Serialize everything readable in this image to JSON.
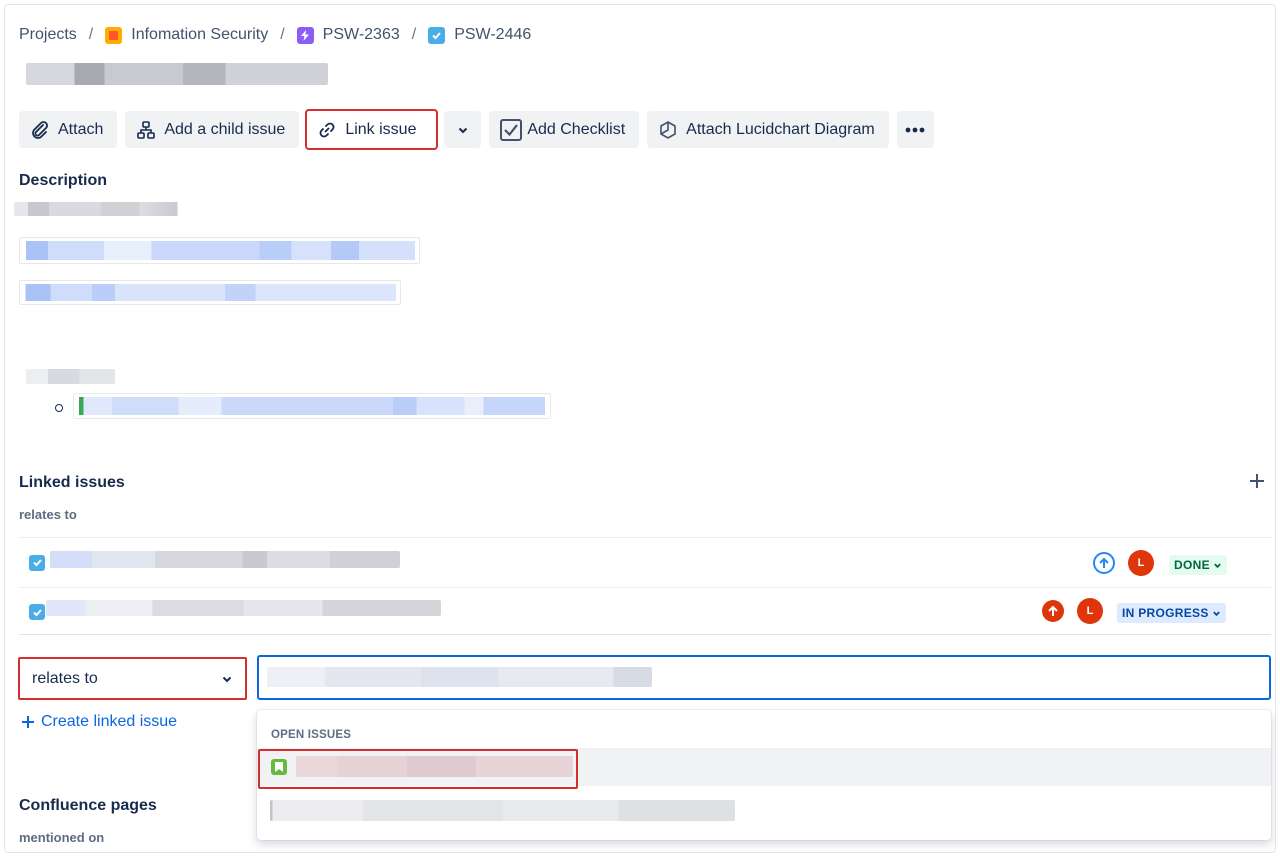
{
  "breadcrumb": {
    "root": "Projects",
    "project": "Infomation Security",
    "epic": "PSW-2363",
    "issue": "PSW-2446",
    "separator": "/"
  },
  "toolbar": {
    "attach": "Attach",
    "add_child": "Add a child issue",
    "link_issue": "Link issue",
    "add_checklist": "Add Checklist",
    "attach_lucidchart": "Attach Lucidchart Diagram"
  },
  "description": {
    "title": "Description"
  },
  "linked_issues": {
    "title": "Linked issues",
    "relation": "relates to",
    "add_icon": "plus-icon",
    "rows": [
      {
        "status": "DONE",
        "priority_icon": "arrow-up-blue-icon",
        "avatar": "L"
      },
      {
        "status": "IN PROGRESS",
        "priority_icon": "arrow-up-red-icon",
        "avatar": "L"
      }
    ]
  },
  "link_form": {
    "relation_value": "relates to",
    "create_linked_issue": "Create linked issue",
    "dropdown_header": "OPEN ISSUES"
  },
  "confluence": {
    "title": "Confluence pages",
    "relation": "mentioned on"
  },
  "colors": {
    "accent": "#0c66e4",
    "highlight": "#d32f2f",
    "done_bg": "#e3fcef",
    "progress_bg": "#deebff"
  }
}
